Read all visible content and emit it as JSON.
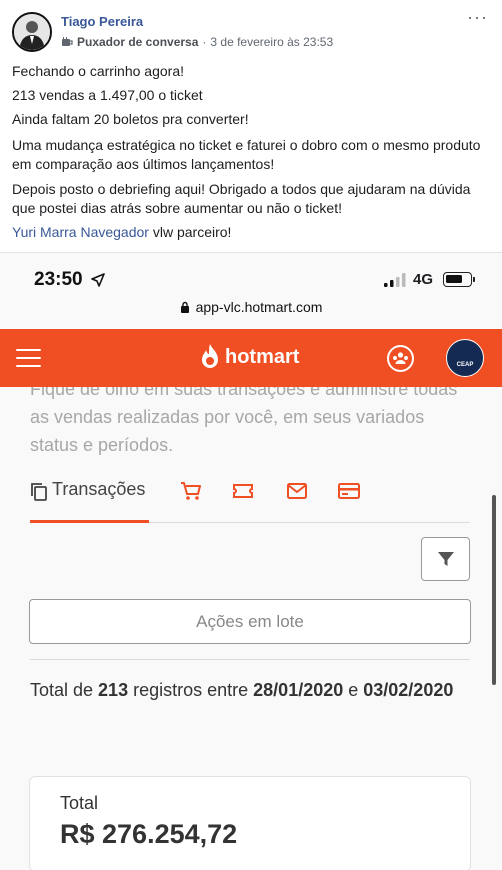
{
  "post": {
    "author": "Tiago Pereira",
    "badge": "Puxador de conversa",
    "separator": "·",
    "timestamp": "3 de fevereiro às 23:53",
    "more": "···",
    "lines": [
      "Fechando o carrinho agora!",
      "213 vendas a 1.497,00 o ticket",
      "Ainda faltam 20 boletos pra converter!",
      "Uma mudança estratégica no ticket e faturei o dobro com o mesmo produto em comparação aos últimos lançamentos!",
      "Depois posto o debriefing aqui! Obrigado a todos que ajudaram na dúvida que postei dias atrás sobre aumentar ou não o ticket!"
    ],
    "mention": "Yuri Marra Navegador",
    "mention_suffix": " vlw parceiro!"
  },
  "phone": {
    "time": "23:50",
    "network": "4G",
    "url": "app-vlc.hotmart.com",
    "brand": "hotmart",
    "avatar_text": "CEAP",
    "intro": "Fique de olho em suas transações e administre todas as vendas realizadas por você, em seus variados status e períodos.",
    "tabs": {
      "active": "Transações",
      "icons": [
        "cart-icon",
        "ticket-icon",
        "mail-icon",
        "card-icon"
      ]
    },
    "bulk_actions": "Ações em lote",
    "summary": {
      "prefix": "Total de ",
      "count": "213",
      "middle": " registros entre ",
      "start": "28/01/2020",
      "conj": " e ",
      "end": "03/02/2020"
    },
    "total_label": "Total",
    "total_value": "R$ 276.254,72",
    "accent": "#f04e23"
  }
}
